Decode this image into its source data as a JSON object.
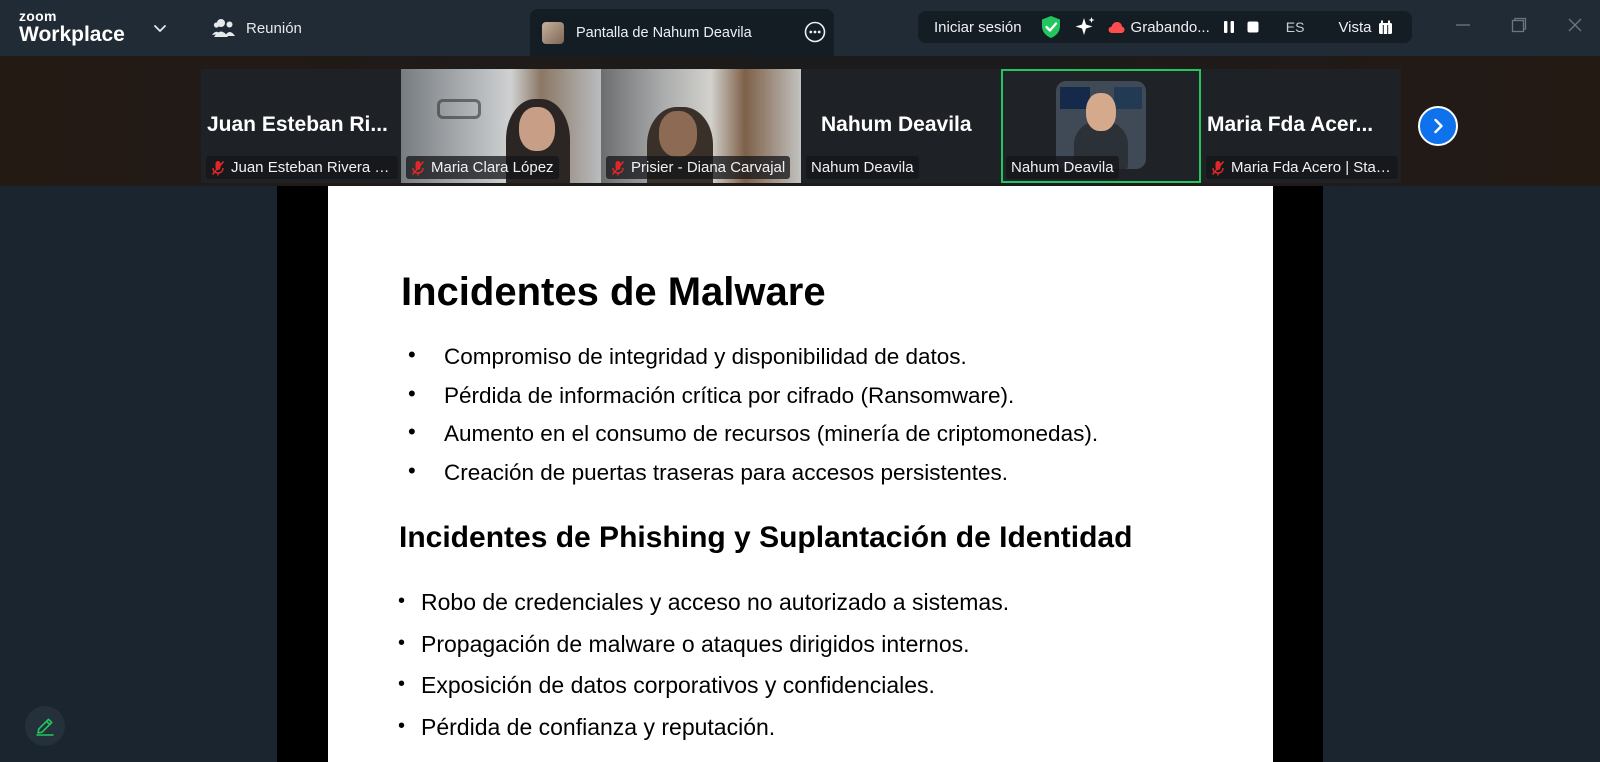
{
  "titlebar": {
    "brand_top": "zoom",
    "brand_bottom": "Workplace",
    "meeting_label": "Reunión",
    "share_tab_label": "Pantalla de Nahum Deavila",
    "toolbar": {
      "sign_in": "Iniciar sesión",
      "recording": "Grabando...",
      "language": "ES",
      "view": "Vista"
    }
  },
  "participants": [
    {
      "big_name": "Juan Esteban Ri...",
      "tag": "Juan Esteban Rivera - ...",
      "muted": true,
      "video": false
    },
    {
      "big_name": "",
      "tag": "Maria Clara López",
      "muted": true,
      "video": true
    },
    {
      "big_name": "",
      "tag": "Prisier - Diana Carvajal",
      "muted": true,
      "video": true
    },
    {
      "big_name": "Nahum Deavila",
      "tag": "Nahum Deavila",
      "muted": false,
      "video": false
    },
    {
      "big_name": "",
      "tag": "Nahum Deavila",
      "muted": false,
      "video": true,
      "speaking": true
    },
    {
      "big_name": "Maria Fda Acer...",
      "tag": "Maria Fda Acero | Start...",
      "muted": true,
      "video": false
    }
  ],
  "slide": {
    "title": "Incidentes de Malware",
    "bullets_1": [
      "Compromiso de integridad y disponibilidad de datos.",
      "Pérdida de información crítica por cifrado (Ransomware).",
      "Aumento en el consumo de recursos (minería de criptomonedas).",
      "Creación de puertas traseras para accesos persistentes."
    ],
    "subtitle": "Incidentes de Phishing y Suplantación de Identidad",
    "bullets_2": [
      "Robo de credenciales y acceso no autorizado a sistemas.",
      "Propagación de malware o ataques dirigidos internos.",
      "Exposición de datos corporativos y confidenciales.",
      "Pérdida de confianza y reputación."
    ]
  },
  "icons": {
    "brand_chevron": "chevron-down-icon",
    "meeting": "people-icon",
    "share_more": "more-icon",
    "shield": "shield-check-icon",
    "ai": "sparkle-icon",
    "cloud": "cloud-record-icon",
    "pause": "pause-icon",
    "stop": "stop-icon",
    "view": "grid-view-icon",
    "next": "chevron-right-icon",
    "annotate": "pencil-icon",
    "mic_off": "mic-off-icon"
  },
  "colors": {
    "titlebar_bg": "#212b35",
    "app_bg": "#1a2530",
    "accent_blue": "#0e72ed",
    "speaking_border": "#22c55e",
    "shield_green": "#22c55e",
    "mic_off_red": "#e02828"
  }
}
